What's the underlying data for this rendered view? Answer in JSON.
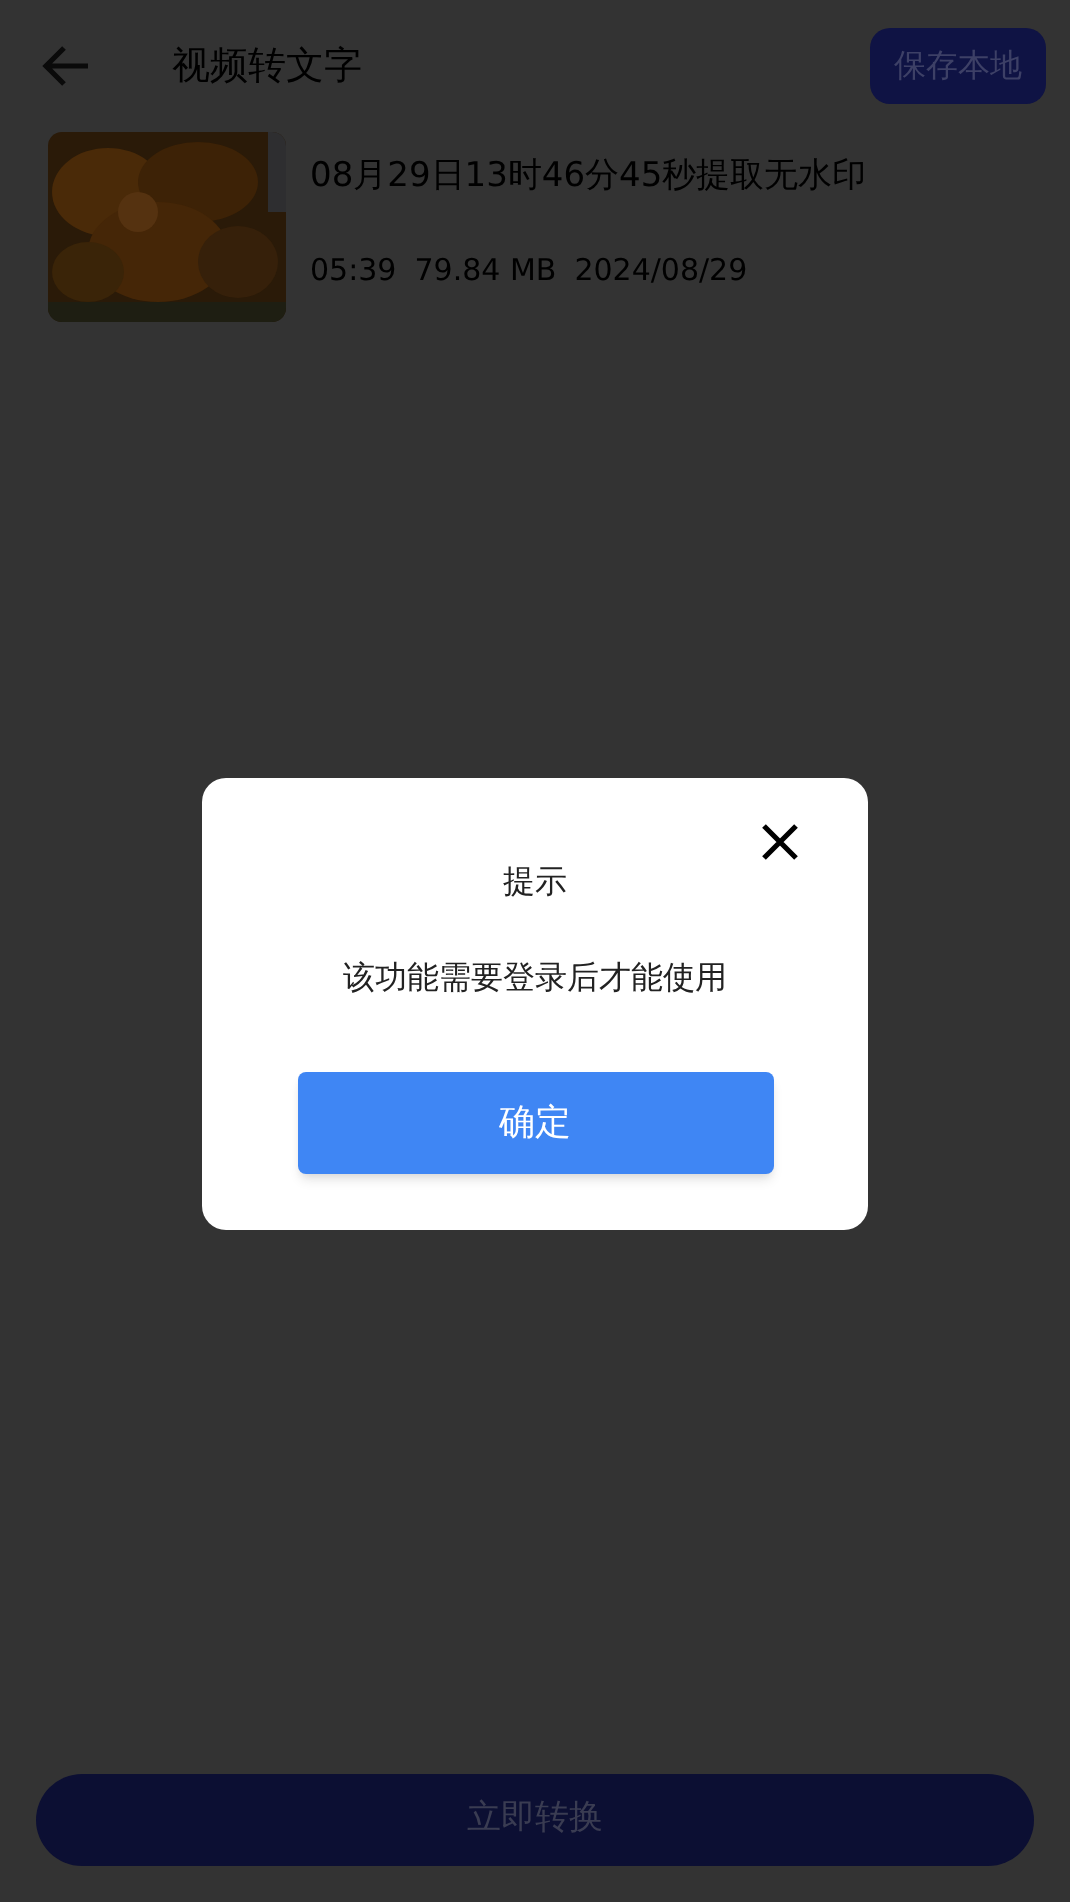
{
  "header": {
    "title": "视频转文字",
    "action": "保存本地"
  },
  "video": {
    "title": "08月29日13时46分45秒提取无水印",
    "duration": "05:39",
    "size": "79.84 MB",
    "date": "2024/08/29"
  },
  "dialog": {
    "title": "提示",
    "message": "该功能需要登录后才能使用",
    "confirm": "确定"
  },
  "convert_button": "立即转换"
}
